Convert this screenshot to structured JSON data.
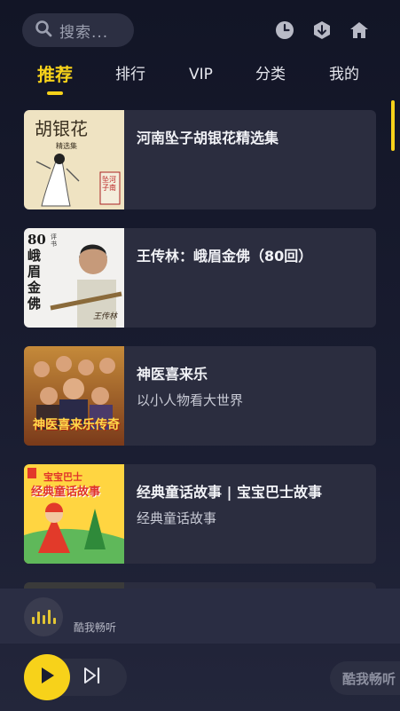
{
  "search": {
    "placeholder": "搜索...",
    "icon": "search-icon"
  },
  "top_icons": [
    "history-clock-icon",
    "download-icon",
    "home-icon"
  ],
  "tabs": [
    {
      "label": "推荐",
      "active": true
    },
    {
      "label": "排行",
      "active": false
    },
    {
      "label": "VIP",
      "active": false
    },
    {
      "label": "分类",
      "active": false
    },
    {
      "label": "我的",
      "active": false
    }
  ],
  "items": [
    {
      "title": "河南坠子胡银花精选集",
      "subtitle": "",
      "cover": {
        "heading": "胡银花",
        "sub": "精选集",
        "seal": "坠河子南"
      }
    },
    {
      "title": "王传林：峨眉金佛（80回）",
      "subtitle": "",
      "cover": {
        "heading": "80峨眉金佛",
        "tag": "评书",
        "signature": "王传林"
      }
    },
    {
      "title": "神医喜来乐",
      "subtitle": "以小人物看大世界",
      "cover": {
        "heading": "神医喜来乐传奇"
      }
    },
    {
      "title": "经典童话故事 | 宝宝巴士故事",
      "subtitle": "经典童话故事",
      "cover": {
        "line1": "宝宝巴士",
        "line2": "经典童话故事"
      }
    }
  ],
  "player": {
    "name": "酷我畅听",
    "play_icon": "play-icon",
    "next_icon": "skip-next-icon",
    "brand": "酷我畅听"
  },
  "colors": {
    "accent": "#f7d21a",
    "card": "#2b2d3f",
    "background": "#121526"
  }
}
